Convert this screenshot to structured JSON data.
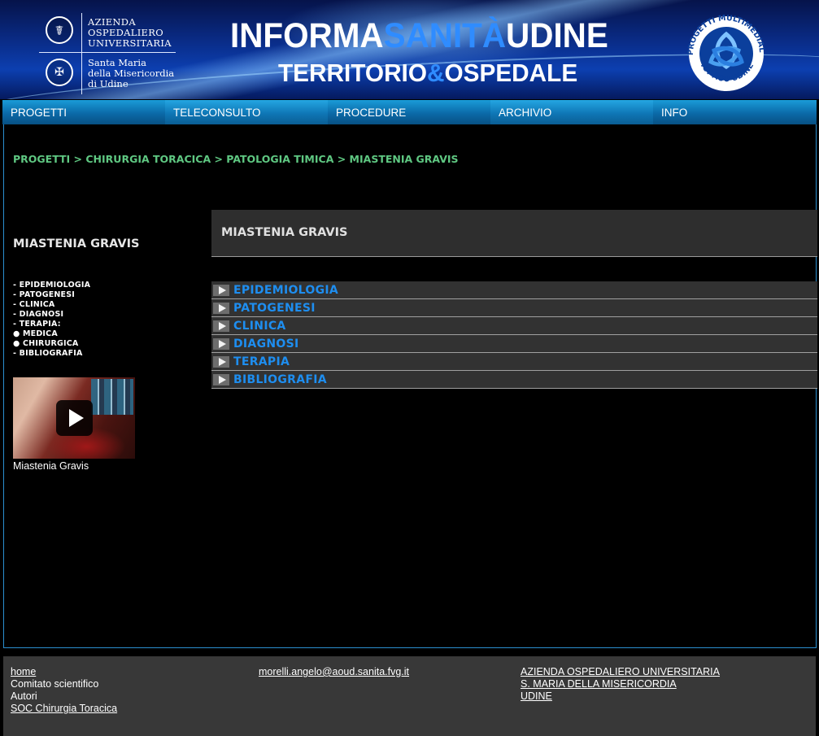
{
  "header": {
    "org_top": "AZIENDA\nOSPEDALIERO\nUNIVERSITARIA",
    "org_bottom": "Santa Maria\ndella Misericordia\ndi Udine",
    "title_line1_a": "INFORMA",
    "title_line1_b": "SANITÀ",
    "title_line1_c": "UDINE",
    "title_line2_a": "TERRITORIO",
    "title_line2_b": "&",
    "title_line2_c": "OSPEDALE",
    "logo_right_top": "PROGETTI MULTIMEDIALI",
    "logo_right_bottom": "ICT AOU UDINE"
  },
  "nav": {
    "items": [
      {
        "label": "PROGETTI"
      },
      {
        "label": "TELECONSULTO"
      },
      {
        "label": "PROCEDURE"
      },
      {
        "label": "ARCHIVIO"
      },
      {
        "label": "INFO"
      }
    ]
  },
  "breadcrumb": "PROGETTI > CHIRURGIA TORACICA > PATOLOGIA TIMICA > MIASTENIA GRAVIS",
  "sidebar": {
    "title": "MIASTENIA GRAVIS",
    "items": [
      "- EPIDEMIOLOGIA",
      "- PATOGENESI",
      "- CLINICA",
      "- DIAGNOSI",
      "- TERAPIA:",
      "● MEDICA",
      "● CHIRURGICA",
      "- BIBLIOGRAFIA"
    ],
    "video_caption": "Miastenia Gravis"
  },
  "main": {
    "title": "MIASTENIA GRAVIS",
    "sections": [
      {
        "label": "EPIDEMIOLOGIA"
      },
      {
        "label": "PATOGENESI"
      },
      {
        "label": "CLINICA"
      },
      {
        "label": "DIAGNOSI"
      },
      {
        "label": "TERAPIA"
      },
      {
        "label": "BIBLIOGRAFIA"
      }
    ]
  },
  "footer": {
    "col1": {
      "home": "home",
      "comitato": "Comitato scientifico",
      "autori": "Autori",
      "soc": "SOC Chirurgia Toracica"
    },
    "col2": {
      "email": "morelli.angelo@aoud.sanita.fvg.it"
    },
    "col3": {
      "line1": "AZIENDA OSPEDALIERO UNIVERSITARIA",
      "line2": "S. MARIA DELLA MISERICORDIA",
      "line3": "UDINE"
    }
  },
  "colors": {
    "nav_blue": "#0b6aa8",
    "breadcrumb_green": "#5fc882",
    "section_link_blue": "#1e8ef0",
    "footer_bg": "#383838"
  }
}
